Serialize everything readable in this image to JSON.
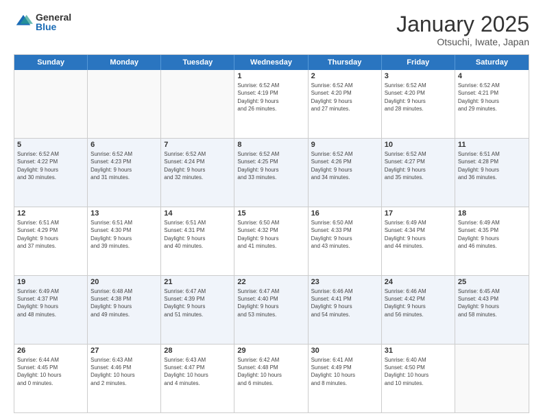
{
  "logo": {
    "general": "General",
    "blue": "Blue"
  },
  "title": "January 2025",
  "subtitle": "Otsuchi, Iwate, Japan",
  "days_of_week": [
    "Sunday",
    "Monday",
    "Tuesday",
    "Wednesday",
    "Thursday",
    "Friday",
    "Saturday"
  ],
  "weeks": [
    [
      {
        "day": "",
        "info": ""
      },
      {
        "day": "",
        "info": ""
      },
      {
        "day": "",
        "info": ""
      },
      {
        "day": "1",
        "info": "Sunrise: 6:52 AM\nSunset: 4:19 PM\nDaylight: 9 hours\nand 26 minutes."
      },
      {
        "day": "2",
        "info": "Sunrise: 6:52 AM\nSunset: 4:20 PM\nDaylight: 9 hours\nand 27 minutes."
      },
      {
        "day": "3",
        "info": "Sunrise: 6:52 AM\nSunset: 4:20 PM\nDaylight: 9 hours\nand 28 minutes."
      },
      {
        "day": "4",
        "info": "Sunrise: 6:52 AM\nSunset: 4:21 PM\nDaylight: 9 hours\nand 29 minutes."
      }
    ],
    [
      {
        "day": "5",
        "info": "Sunrise: 6:52 AM\nSunset: 4:22 PM\nDaylight: 9 hours\nand 30 minutes."
      },
      {
        "day": "6",
        "info": "Sunrise: 6:52 AM\nSunset: 4:23 PM\nDaylight: 9 hours\nand 31 minutes."
      },
      {
        "day": "7",
        "info": "Sunrise: 6:52 AM\nSunset: 4:24 PM\nDaylight: 9 hours\nand 32 minutes."
      },
      {
        "day": "8",
        "info": "Sunrise: 6:52 AM\nSunset: 4:25 PM\nDaylight: 9 hours\nand 33 minutes."
      },
      {
        "day": "9",
        "info": "Sunrise: 6:52 AM\nSunset: 4:26 PM\nDaylight: 9 hours\nand 34 minutes."
      },
      {
        "day": "10",
        "info": "Sunrise: 6:52 AM\nSunset: 4:27 PM\nDaylight: 9 hours\nand 35 minutes."
      },
      {
        "day": "11",
        "info": "Sunrise: 6:51 AM\nSunset: 4:28 PM\nDaylight: 9 hours\nand 36 minutes."
      }
    ],
    [
      {
        "day": "12",
        "info": "Sunrise: 6:51 AM\nSunset: 4:29 PM\nDaylight: 9 hours\nand 37 minutes."
      },
      {
        "day": "13",
        "info": "Sunrise: 6:51 AM\nSunset: 4:30 PM\nDaylight: 9 hours\nand 39 minutes."
      },
      {
        "day": "14",
        "info": "Sunrise: 6:51 AM\nSunset: 4:31 PM\nDaylight: 9 hours\nand 40 minutes."
      },
      {
        "day": "15",
        "info": "Sunrise: 6:50 AM\nSunset: 4:32 PM\nDaylight: 9 hours\nand 41 minutes."
      },
      {
        "day": "16",
        "info": "Sunrise: 6:50 AM\nSunset: 4:33 PM\nDaylight: 9 hours\nand 43 minutes."
      },
      {
        "day": "17",
        "info": "Sunrise: 6:49 AM\nSunset: 4:34 PM\nDaylight: 9 hours\nand 44 minutes."
      },
      {
        "day": "18",
        "info": "Sunrise: 6:49 AM\nSunset: 4:35 PM\nDaylight: 9 hours\nand 46 minutes."
      }
    ],
    [
      {
        "day": "19",
        "info": "Sunrise: 6:49 AM\nSunset: 4:37 PM\nDaylight: 9 hours\nand 48 minutes."
      },
      {
        "day": "20",
        "info": "Sunrise: 6:48 AM\nSunset: 4:38 PM\nDaylight: 9 hours\nand 49 minutes."
      },
      {
        "day": "21",
        "info": "Sunrise: 6:47 AM\nSunset: 4:39 PM\nDaylight: 9 hours\nand 51 minutes."
      },
      {
        "day": "22",
        "info": "Sunrise: 6:47 AM\nSunset: 4:40 PM\nDaylight: 9 hours\nand 53 minutes."
      },
      {
        "day": "23",
        "info": "Sunrise: 6:46 AM\nSunset: 4:41 PM\nDaylight: 9 hours\nand 54 minutes."
      },
      {
        "day": "24",
        "info": "Sunrise: 6:46 AM\nSunset: 4:42 PM\nDaylight: 9 hours\nand 56 minutes."
      },
      {
        "day": "25",
        "info": "Sunrise: 6:45 AM\nSunset: 4:43 PM\nDaylight: 9 hours\nand 58 minutes."
      }
    ],
    [
      {
        "day": "26",
        "info": "Sunrise: 6:44 AM\nSunset: 4:45 PM\nDaylight: 10 hours\nand 0 minutes."
      },
      {
        "day": "27",
        "info": "Sunrise: 6:43 AM\nSunset: 4:46 PM\nDaylight: 10 hours\nand 2 minutes."
      },
      {
        "day": "28",
        "info": "Sunrise: 6:43 AM\nSunset: 4:47 PM\nDaylight: 10 hours\nand 4 minutes."
      },
      {
        "day": "29",
        "info": "Sunrise: 6:42 AM\nSunset: 4:48 PM\nDaylight: 10 hours\nand 6 minutes."
      },
      {
        "day": "30",
        "info": "Sunrise: 6:41 AM\nSunset: 4:49 PM\nDaylight: 10 hours\nand 8 minutes."
      },
      {
        "day": "31",
        "info": "Sunrise: 6:40 AM\nSunset: 4:50 PM\nDaylight: 10 hours\nand 10 minutes."
      },
      {
        "day": "",
        "info": ""
      }
    ]
  ]
}
